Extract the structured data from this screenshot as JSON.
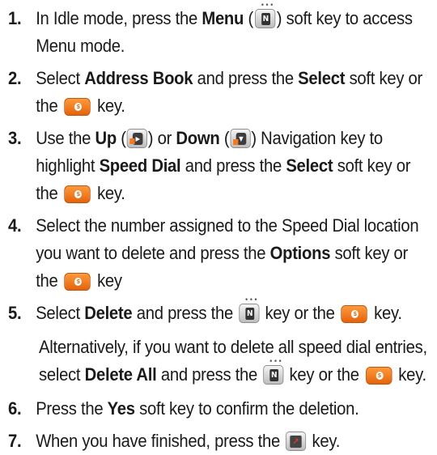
{
  "steps": [
    {
      "num": "1.",
      "t1": "In Idle mode, press the ",
      "b1": "Menu",
      "t2": " (",
      "t3": ") soft key to access Menu mode."
    },
    {
      "num": "2.",
      "t1": "Select ",
      "b1": "Address Book",
      "t2": " and press the ",
      "b2": "Select",
      "t3": " soft key or the ",
      "t4": " key."
    },
    {
      "num": "3.",
      "t1": "Use the ",
      "b1": "Up",
      "t2": " (",
      "t3": ") or ",
      "b2": "Down",
      "t4": " (",
      "t5": ") Navigation key to highlight ",
      "b3": "Speed Dial",
      "t6": " and press the ",
      "b4": "Select",
      "t7": " soft key or the ",
      "t8": " key."
    },
    {
      "num": "4.",
      "t1": "Select the number assigned to the Speed Dial location you want to delete and press the ",
      "b1": "Options",
      "t2": " soft key or the ",
      "t3": " key"
    },
    {
      "num": "5.",
      "t1": "Select ",
      "b1": "Delete",
      "t2": " and press the ",
      "t3": " key or the ",
      "t4": " key.",
      "alt_t1": "Alternatively, if you want to delete all speed dial entries, select ",
      "alt_b1": "Delete All",
      "alt_t2": " and press the ",
      "alt_t3": " key or the ",
      "alt_t4": " key."
    },
    {
      "num": "6.",
      "t1": "Press the ",
      "b1": "Yes",
      "t2": " soft key to confirm the deletion."
    },
    {
      "num": "7.",
      "t1": "When you have finished, press the ",
      "t2": " key."
    }
  ],
  "icons": {
    "menu_key": "menu-key-icon",
    "ok_key": "ok-key-icon",
    "nav_up_key": "nav-up-key-icon",
    "nav_down_key": "nav-down-key-icon",
    "end_key": "end-key-icon"
  },
  "colors": {
    "ok_key": "#f47a20",
    "end_mark": "#e4392c",
    "text": "#1a1a1a"
  }
}
